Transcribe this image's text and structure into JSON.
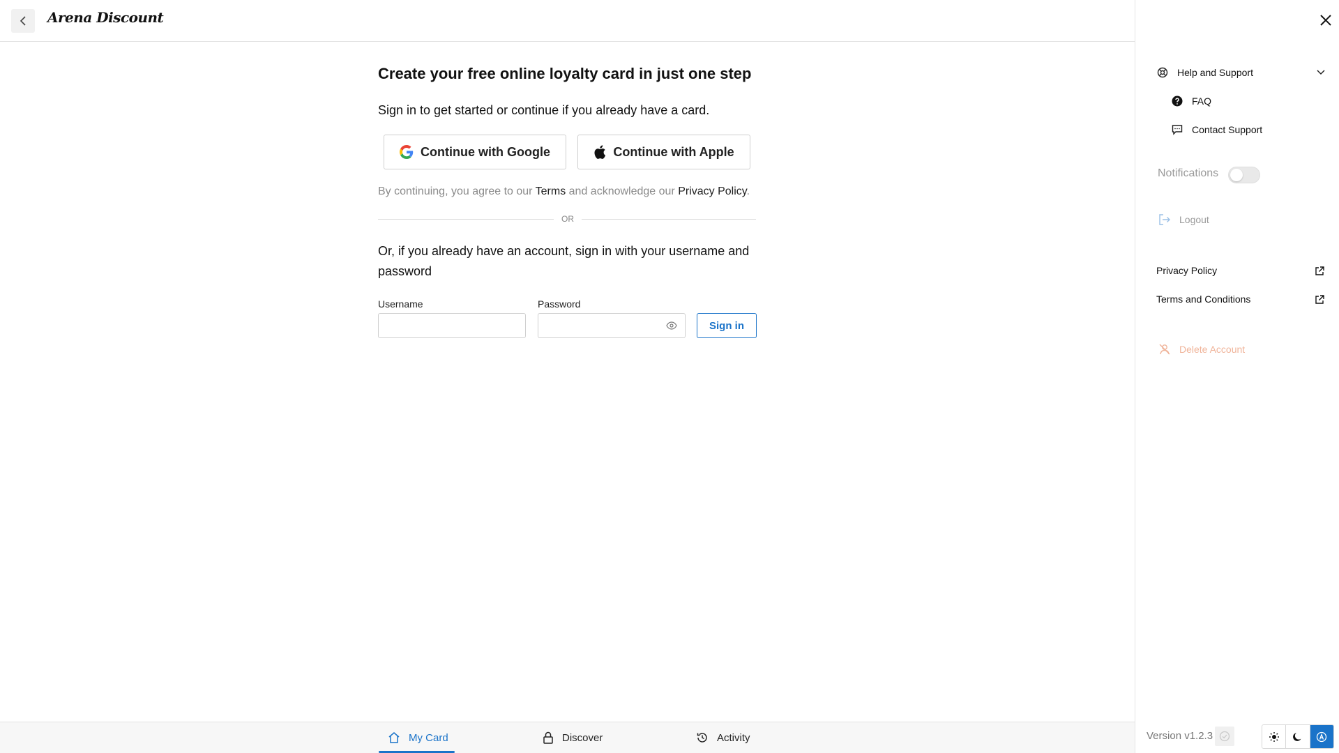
{
  "header": {
    "brand": "Arena Discount"
  },
  "main": {
    "title": "Create your free online loyalty card in just one step",
    "subtitle": "Sign in to get started or continue if you already have a card.",
    "google_label": "Continue with Google",
    "apple_label": "Continue with Apple",
    "legal_prefix": "By continuing, you agree to our ",
    "terms_link": "Terms",
    "legal_middle": " and acknowledge our ",
    "privacy_link": "Privacy Policy",
    "legal_suffix": ".",
    "or_label": "OR",
    "alt_text": "Or, if you already have an account, sign in with your username and password",
    "username_label": "Username",
    "username_value": "",
    "password_label": "Password",
    "password_value": "",
    "signin_label": "Sign in"
  },
  "bottom_nav": {
    "items": [
      {
        "label": "My Card",
        "icon": "home-icon",
        "active": true
      },
      {
        "label": "Discover",
        "icon": "lock-icon",
        "active": false
      },
      {
        "label": "Activity",
        "icon": "history-icon",
        "active": false
      }
    ]
  },
  "panel": {
    "help_label": "Help and Support",
    "faq_label": "FAQ",
    "contact_label": "Contact Support",
    "notifications_label": "Notifications",
    "notifications_on": false,
    "logout_label": "Logout",
    "privacy_label": "Privacy Policy",
    "terms_label": "Terms and Conditions",
    "delete_label": "Delete Account",
    "version_label": "Version v1.2.3",
    "theme_options": [
      "light",
      "dark",
      "auto"
    ],
    "theme_selected": "auto"
  },
  "colors": {
    "accent": "#1a73c9",
    "muted": "#9a9a9a",
    "danger_muted": "#f0b49a"
  }
}
